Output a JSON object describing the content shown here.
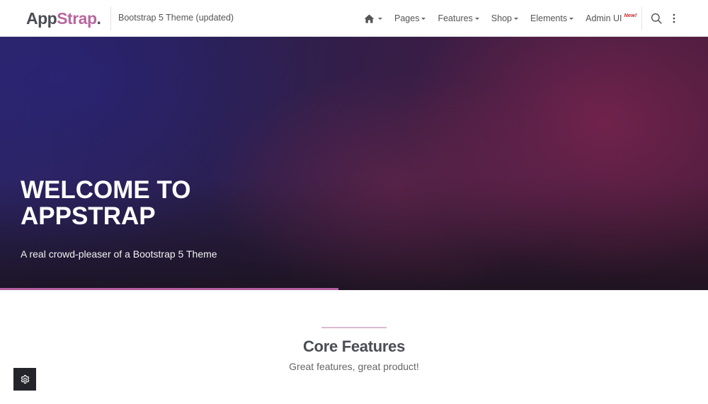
{
  "header": {
    "logo": {
      "part1": "App",
      "part2": "Strap",
      "part3": "."
    },
    "tagline": "Bootstrap 5 Theme (updated)",
    "nav": [
      {
        "label": "Pages"
      },
      {
        "label": "Features"
      },
      {
        "label": "Shop"
      },
      {
        "label": "Elements"
      },
      {
        "label": "Admin UI",
        "badge": "New!"
      }
    ],
    "icons": {
      "home": "home-icon",
      "search": "search-icon",
      "more": "more-vertical-icon"
    }
  },
  "hero": {
    "title": "WELCOME TO APPSTRAP",
    "subtitle": "A real crowd-pleaser of a Bootstrap 5 Theme",
    "progress": 0.478
  },
  "features": {
    "title": "Core Features",
    "subtitle": "Great features, great product!"
  },
  "settings": {
    "icon": "gear-icon"
  },
  "colors": {
    "accent": "#b9679f",
    "dark_text": "#4a4d54",
    "badge_red": "#c8282e",
    "settings_bg": "#23252b"
  }
}
